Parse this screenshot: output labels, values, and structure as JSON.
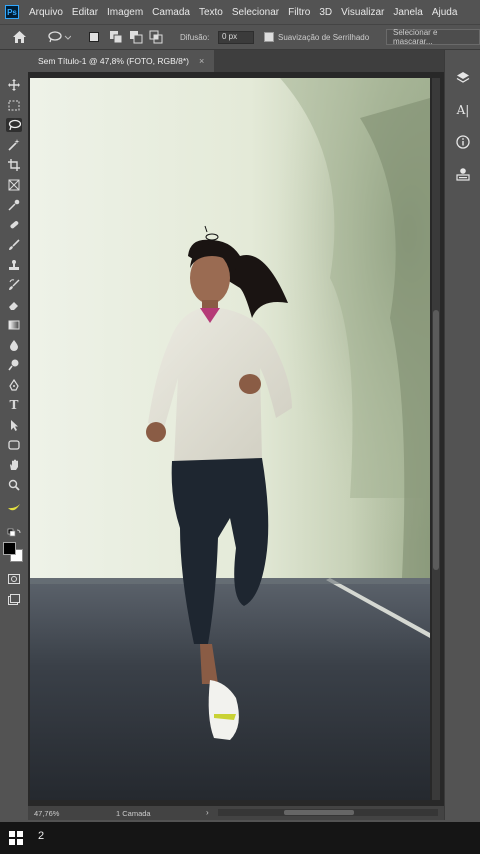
{
  "app": {
    "logo": "Ps"
  },
  "menu": [
    "Arquivo",
    "Editar",
    "Imagem",
    "Camada",
    "Texto",
    "Selecionar",
    "Filtro",
    "3D",
    "Visualizar",
    "Janela",
    "Ajuda"
  ],
  "options_bar": {
    "feather_label": "Difusão:",
    "feather_value": "0 px",
    "antialias_label": "Suavização de Serrilhado",
    "select_mask_label": "Selecionar e mascarar..."
  },
  "document": {
    "tab_title": "Sem Título-1 @ 47,8% (FOTO, RGB/8*)",
    "close_glyph": "×"
  },
  "status_bar": {
    "zoom": "47,76%",
    "layers": "1 Camada",
    "arrow": "›"
  },
  "taskbar": {
    "number": "2"
  },
  "colors": {
    "foreground": "#000000",
    "background": "#ffffff",
    "ui_bg": "#535353",
    "ps_blue": "#31a8ff"
  },
  "tools": [
    "move-icon",
    "marquee-icon",
    "lasso-icon",
    "magic-wand-icon",
    "crop-icon",
    "frame-icon",
    "eyedropper-icon",
    "healing-brush-icon",
    "brush-icon",
    "clone-stamp-icon",
    "history-brush-icon",
    "eraser-icon",
    "gradient-icon",
    "blur-icon",
    "dodge-icon",
    "pen-icon",
    "type-icon",
    "path-selection-icon",
    "shape-icon",
    "hand-icon",
    "zoom-icon",
    "edit-toolbar-icon"
  ],
  "right_panel_icons": [
    "layers-icon",
    "character-icon",
    "info-icon",
    "properties-icon"
  ]
}
